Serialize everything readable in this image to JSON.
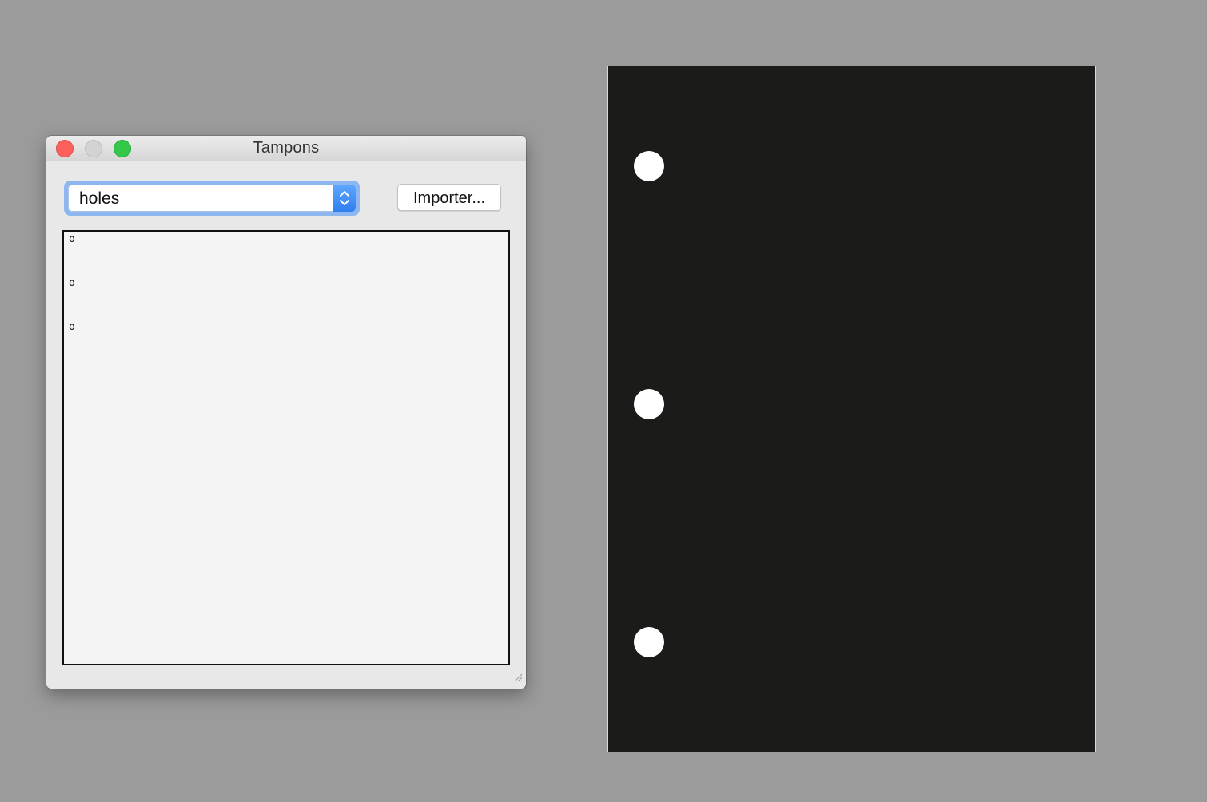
{
  "window": {
    "title": "Tampons"
  },
  "stamp_select": {
    "selected": "holes"
  },
  "toolbar": {
    "import_label": "Importer..."
  },
  "stamp_list": {
    "items": [
      "o",
      "o",
      "o"
    ]
  },
  "preview": {
    "background_color": "#1b1b19",
    "hole_color": "#ffffff",
    "hole_count": 3
  }
}
